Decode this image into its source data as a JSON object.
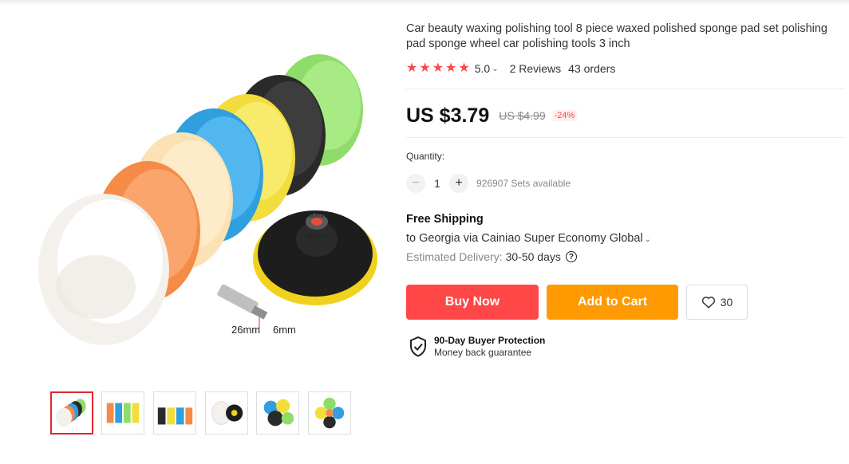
{
  "product": {
    "title": "Car beauty waxing polishing tool 8 piece waxed polished sponge pad set polishing pad sponge wheel car polishing tools 3 inch"
  },
  "rating": {
    "stars": 5,
    "value": "5.0",
    "reviews": "2 Reviews",
    "orders": "43 orders"
  },
  "price": {
    "current": "US $3.79",
    "original": "US $4.99",
    "discount": "-24%"
  },
  "quantity": {
    "label": "Quantity:",
    "value": "1",
    "decrement": "−",
    "increment": "+",
    "available": "926907 Sets available"
  },
  "shipping": {
    "title": "Free Shipping",
    "destination": "to Georgia via Cainiao Super Economy Global",
    "estimate_label": "Estimated Delivery:",
    "estimate_days": "30-50 days",
    "help_glyph": "?"
  },
  "actions": {
    "buy_now": "Buy Now",
    "add_to_cart": "Add to Cart",
    "wishlist_count": "30"
  },
  "protection": {
    "title": "90-Day Buyer Protection",
    "subtitle": "Money back guarantee"
  },
  "image_labels": {
    "outer_diameter": "30mm",
    "inner_diameter": "15mm",
    "shaft_length": "26mm",
    "shaft_diameter": "6mm"
  },
  "thumbnails": {
    "count": 6,
    "active_index": 0
  },
  "colors": {
    "accent_red": "#ff4747",
    "accent_orange": "#ff9a03",
    "star": "#ff4747",
    "active_thumb_border": "#e0262d"
  },
  "icons": {
    "star": "star-icon",
    "chevron": "chevron-down-icon",
    "help": "help-circle-icon",
    "heart": "heart-icon",
    "shield": "shield-check-icon"
  }
}
